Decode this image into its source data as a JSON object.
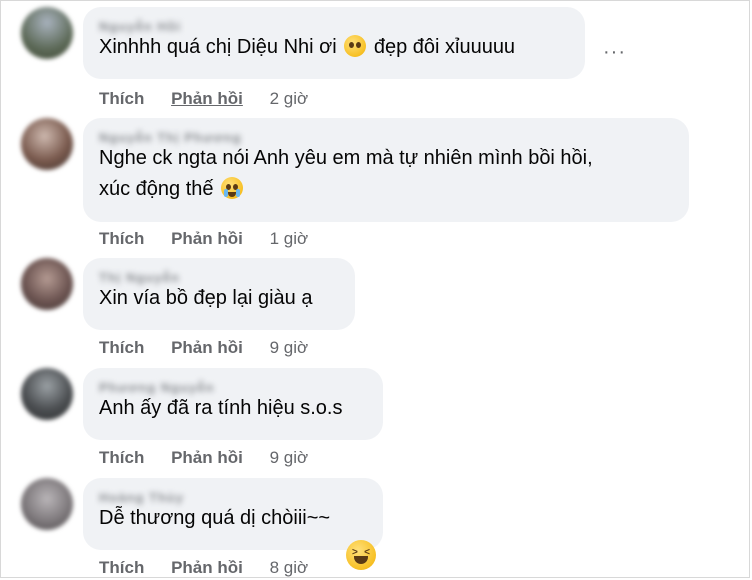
{
  "comments": [
    {
      "name": "Nguyễn Hồi",
      "text": "Xinhhh quá chị Diệu Nhi ơi",
      "text2": "đẹp đôi xỉuuuuu",
      "like": "Thích",
      "reply": "Phản hồi",
      "time": "2 giờ"
    },
    {
      "name": "Nguyễn Thị Phương",
      "text": "Nghe ck ngta nói Anh yêu em mà tự nhiên mình bồi hồi,",
      "text2": "xúc động thế",
      "like": "Thích",
      "reply": "Phản hồi",
      "time": "1 giờ"
    },
    {
      "name": "Thị Nguyễn",
      "text": "Xin vía bồ đẹp lại giàu ạ",
      "like": "Thích",
      "reply": "Phản hồi",
      "time": "9 giờ"
    },
    {
      "name": "Phương Nguyễn",
      "text": "Anh ấy đã ra tính hiệu s.o.s",
      "like": "Thích",
      "reply": "Phản hồi",
      "time": "9 giờ"
    },
    {
      "name": "Hoàng Thùy",
      "text": "Dễ thương quá dị chòiii~~",
      "like": "Thích",
      "reply": "Phản hồi",
      "time": "8 giờ"
    }
  ],
  "more_options": "···",
  "colors": {
    "bubble": "#f0f2f5",
    "action": "#65676b",
    "text": "#050505"
  },
  "icons": [
    "pleading-face-icon",
    "crying-face-icon",
    "grinning-squinting-face-icon",
    "more-options-icon"
  ]
}
